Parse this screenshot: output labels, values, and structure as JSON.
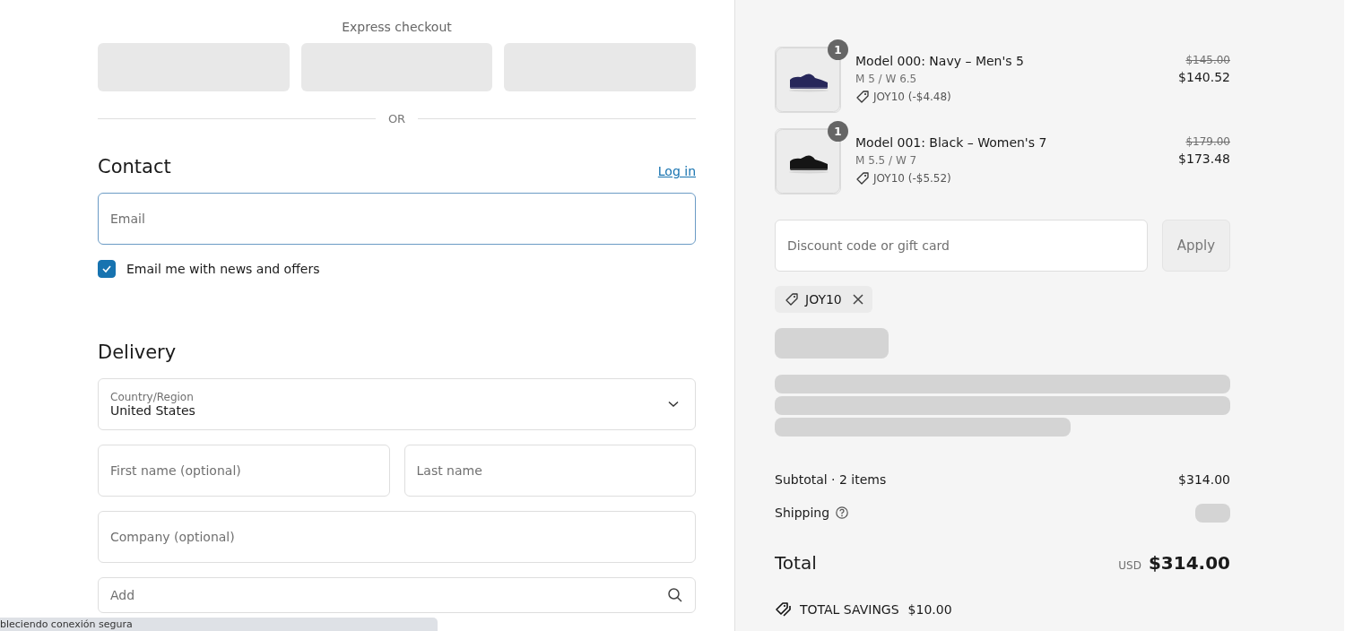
{
  "express_checkout": {
    "title": "Express checkout",
    "buttons": [
      {
        "kind": "placeholder"
      },
      {
        "kind": "placeholder"
      },
      {
        "kind": "placeholder"
      }
    ],
    "divider": "OR"
  },
  "contact": {
    "heading": "Contact",
    "login_link": "Log in",
    "email": {
      "placeholder": "Email",
      "focused": true
    },
    "newsletter": {
      "label": "Email me with news and offers",
      "checked": true
    }
  },
  "delivery": {
    "heading": "Delivery",
    "country": {
      "label": "Country/Region",
      "value": "United States"
    },
    "fields": [
      {
        "placeholder": "First name (optional)",
        "kind": "half"
      },
      {
        "placeholder": "Last name",
        "kind": "half"
      },
      {
        "placeholder": "Company (optional)",
        "kind": "full"
      },
      {
        "placeholder": "Add",
        "kind": "search"
      }
    ]
  },
  "order_summary": {
    "items": [
      {
        "quantity": "1",
        "name": "Model 000: Navy – Men's 5",
        "variant": "M 5 / W 6.5",
        "discount": "JOY10 (-$4.48)",
        "original_price": "$145.00",
        "price": "$140.52",
        "color": "#27275a"
      },
      {
        "quantity": "1",
        "name": "Model 001: Black – Women's 7",
        "variant": "M 5.5 / W 7",
        "discount": "JOY10 (-$5.52)",
        "original_price": "$179.00",
        "price": "$173.48",
        "color": "#151515"
      }
    ],
    "discount_field": {
      "placeholder": "Discount code or gift card"
    },
    "apply_button": "Apply",
    "applied_code": "JOY10",
    "subtotal": {
      "label": "Subtotal · 2 items",
      "value": "$314.00"
    },
    "shipping": {
      "label": "Shipping",
      "loading": true
    },
    "total": {
      "label": "Total",
      "currency": "USD",
      "value": "$314.00"
    },
    "savings": {
      "label": "TOTAL SAVINGS",
      "value": "$10.00"
    }
  },
  "status_bar": {
    "text": "bleciendo conexión segura"
  }
}
